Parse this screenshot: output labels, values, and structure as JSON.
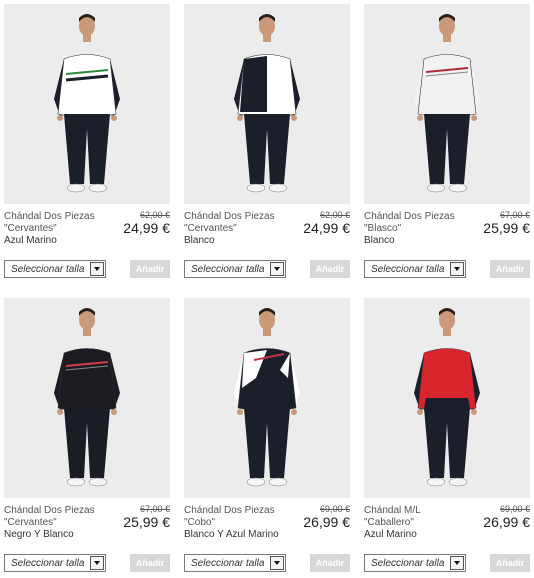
{
  "products": [
    {
      "title": "Chándal Dos Piezas",
      "model": "\"Cervantes\"",
      "color": "Azul Marino",
      "old_price": "62,00 €",
      "price": "24,99 €",
      "select_placeholder": "Seleccionar talla",
      "add_label": "Añadir",
      "jacket": "#ffffff",
      "panel": "#1a1f2a",
      "accent": "#2a8a3a",
      "pants": "#1b1f2a",
      "pattern": "lined"
    },
    {
      "title": "Chándal Dos Piezas",
      "model": "\"Cervantes\"",
      "color": "Blanco",
      "old_price": "62,00 €",
      "price": "24,99 €",
      "select_placeholder": "Seleccionar talla",
      "add_label": "Añadir",
      "jacket": "#ffffff",
      "panel": "#1b1f2a",
      "accent": "#ffffff",
      "pants": "#1b1f2a",
      "pattern": "split"
    },
    {
      "title": "Chándal Dos Piezas",
      "model": "\"Blasco\"",
      "color": "Blanco",
      "old_price": "67,00 €",
      "price": "25,99 €",
      "select_placeholder": "Seleccionar talla",
      "add_label": "Añadir",
      "jacket": "#f2f2f2",
      "panel": "#f2f2f2",
      "accent": "#b02a3a",
      "pants": "#1b1f2a",
      "pattern": "stripe"
    },
    {
      "title": "Chándal Dos Piezas",
      "model": "\"Cervantes\"",
      "color": "Negro Y Blanco",
      "old_price": "67,00 €",
      "price": "25,99 €",
      "select_placeholder": "Seleccionar talla",
      "add_label": "Añadir",
      "jacket": "#1a1c22",
      "panel": "#1a1c22",
      "accent": "#d23a4a",
      "pants": "#1b1d24",
      "pattern": "stripe"
    },
    {
      "title": "Chándal Dos Piezas",
      "model": "\"Cobo\"",
      "color": "Blanco Y Azul Marino",
      "old_price": "69,00 €",
      "price": "26,99 €",
      "select_placeholder": "Seleccionar talla",
      "add_label": "Añadir",
      "jacket": "#1b1f2a",
      "panel": "#ffffff",
      "accent": "#c0344a",
      "pants": "#1b1f2a",
      "pattern": "diag"
    },
    {
      "title": "Chándal M/L",
      "model": "\"Caballero\"",
      "color": "Azul Marino",
      "old_price": "69,00 €",
      "price": "26,99 €",
      "select_placeholder": "Seleccionar talla",
      "add_label": "Añadir",
      "jacket": "#d8242c",
      "panel": "#1b1f2a",
      "accent": "#1b1f2a",
      "pants": "#1b1f2a",
      "pattern": "red"
    }
  ]
}
